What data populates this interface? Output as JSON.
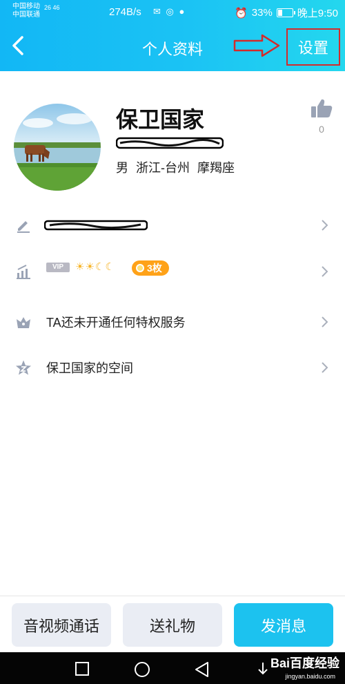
{
  "status_bar": {
    "carrier_1": "中国移动",
    "carrier_2": "中国联通",
    "network": "26 46",
    "speed": "274B/s",
    "battery_level": 33,
    "battery": "33%",
    "time": "晚上9:50"
  },
  "nav": {
    "title": "个人资料",
    "settings_label": "设置"
  },
  "profile": {
    "nickname": "保卫国家",
    "qq_number": "",
    "info": "男  浙江-台州  摩羯座",
    "likes": "0"
  },
  "rows": {
    "signature": "",
    "vip_tag": "VIP",
    "level_icons": "☀☀☾☾",
    "medal_count": "3枚",
    "privilege": "TA还未开通任何特权服务",
    "space": "保卫国家的空间"
  },
  "actions": {
    "call": "音视频通话",
    "gift": "送礼物",
    "message": "发消息"
  },
  "watermark": {
    "brand": "Bai百度经验",
    "url": "jingyan.baidu.com"
  },
  "colors": {
    "header_start": "#12b7f5",
    "header_end": "#24d7ee",
    "highlight": "#d42a2a",
    "message_button": "#1cc2ef"
  }
}
